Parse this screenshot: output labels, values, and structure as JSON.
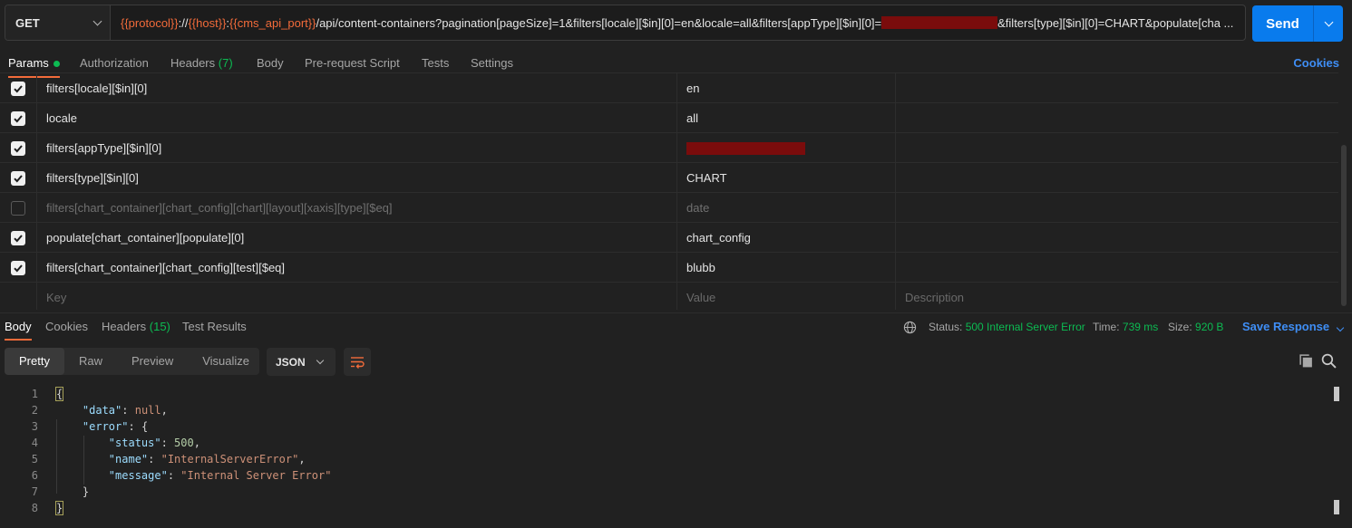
{
  "request": {
    "method": "GET",
    "url": {
      "var_protocol": "{{protocol}}",
      "sep1": "://",
      "var_host": "{{host}}",
      "sep2": ":",
      "var_port": "{{cms_api_port}}",
      "path": "/api/content-containers?pagination[pageSize]=1&filters[locale][$in][0]=en&locale=all&filters[appType][$in][0]=",
      "tail": "&filters[type][$in][0]=CHART&populate[cha ..."
    },
    "send_label": "Send"
  },
  "request_tabs": {
    "params": "Params",
    "authorization": "Authorization",
    "headers": "Headers",
    "headers_count": "(7)",
    "body": "Body",
    "prerequest": "Pre-request Script",
    "tests": "Tests",
    "settings": "Settings",
    "cookies": "Cookies"
  },
  "params": [
    {
      "key": "filters[locale][$in][0]",
      "value": "en",
      "checked": true
    },
    {
      "key": "locale",
      "value": "all",
      "checked": true
    },
    {
      "key": "filters[appType][$in][0]",
      "value": "",
      "checked": true,
      "redacted": true
    },
    {
      "key": "filters[type][$in][0]",
      "value": "CHART",
      "checked": true
    },
    {
      "key": "filters[chart_container][chart_config][chart][layout][xaxis][type][$eq]",
      "value": "date",
      "checked": false
    },
    {
      "key": "populate[chart_container][populate][0]",
      "value": "chart_config",
      "checked": true
    },
    {
      "key": "filters[chart_container][chart_config][test][$eq]",
      "value": "blubb",
      "checked": true
    }
  ],
  "params_placeholder": {
    "key": "Key",
    "value": "Value",
    "description": "Description"
  },
  "response_tabs": {
    "body": "Body",
    "cookies": "Cookies",
    "headers": "Headers",
    "headers_count": "(15)",
    "test_results": "Test Results"
  },
  "response_status": {
    "status_label": "Status:",
    "status_value": "500 Internal Server Error",
    "time_label": "Time:",
    "time_value": "739 ms",
    "size_label": "Size:",
    "size_value": "920 B",
    "save_response": "Save Response"
  },
  "format": {
    "pretty": "Pretty",
    "raw": "Raw",
    "preview": "Preview",
    "visualize": "Visualize",
    "language": "JSON"
  },
  "code": {
    "line_numbers": [
      "1",
      "2",
      "3",
      "4",
      "5",
      "6",
      "7",
      "8"
    ],
    "open_brace": "{",
    "close_brace": "}",
    "data_key": "\"data\"",
    "data_value": "null",
    "error_key": "\"error\"",
    "status_key": "\"status\"",
    "status_value": "500",
    "name_key": "\"name\"",
    "name_value": "\"InternalServerError\"",
    "message_key": "\"message\"",
    "message_value": "\"Internal Server Error\""
  },
  "colors": {
    "accent_orange": "#f26b3a",
    "send_blue": "#097bed",
    "status_green": "#0cbb52",
    "link_blue": "#3f8ef5",
    "redacted": "#7a0c0c"
  }
}
